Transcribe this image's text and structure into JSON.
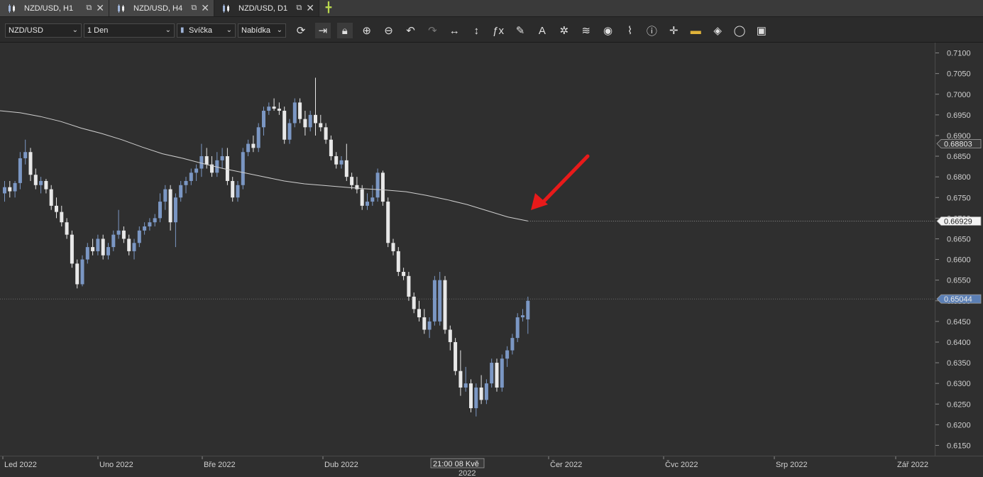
{
  "tabs": [
    {
      "label": "NZD/USD, H1",
      "active": false
    },
    {
      "label": "NZD/USD, H4",
      "active": false
    },
    {
      "label": "NZD/USD, D1",
      "active": true
    }
  ],
  "toolbar": {
    "symbol": "NZD/USD",
    "timeframe": "1 Den",
    "chart_type": "Svíčka",
    "price_side": "Nabídka",
    "tools": [
      "refresh-icon",
      "autoscroll-icon",
      "lock-icon",
      "zoom-in-icon",
      "zoom-out-icon",
      "undo-icon",
      "redo-icon",
      "horizontal-resize-icon",
      "vertical-resize-icon",
      "indicators-fx-icon",
      "pencil-draw-icon",
      "text-tool-icon",
      "crosshair-tools-icon",
      "layers-icon",
      "eye-icon",
      "pattern-icon",
      "info-icon",
      "crosshair-icon",
      "color-bar-icon",
      "fill-bucket-icon",
      "circle-icon",
      "save-icon"
    ]
  },
  "colors": {
    "bull": "#7b97c4",
    "bear": "#e8e8e8",
    "ma": "#cfcfcf",
    "arrow": "#e81a1a",
    "axis_bg": "#2f2f2f"
  },
  "y_labels": [
    "0.7100",
    "0.7050",
    "0.7000",
    "0.6950",
    "0.6900",
    "0.6850",
    "0.6800",
    "0.6750",
    "0.6700",
    "0.6650",
    "0.6600",
    "0.6550",
    "0.6500",
    "0.6450",
    "0.6400",
    "0.6350",
    "0.6300",
    "0.6250",
    "0.6200",
    "0.6150"
  ],
  "price_tags": [
    {
      "label": "0.68803",
      "value": 0.68803,
      "style": "gray"
    },
    {
      "label": "0.66929",
      "value": 0.66929,
      "style": "white"
    },
    {
      "label": "0.65044",
      "value": 0.65044,
      "style": "blue"
    }
  ],
  "x_labels": [
    "Led 2022",
    "Uno 2022",
    "Bře 2022",
    "Dub 2022",
    "Čer 2022",
    "Čvc 2022",
    "Srp 2022",
    "Zář 2022"
  ],
  "cursor_label": {
    "time": "21:00 08 Kvě",
    "year": "2022"
  },
  "chart_data": {
    "type": "candlestick",
    "ylim": [
      0.6125,
      0.7125
    ],
    "ohlc": [
      [
        0.676,
        0.679,
        0.674,
        0.6775
      ],
      [
        0.6775,
        0.679,
        0.675,
        0.6765
      ],
      [
        0.6765,
        0.679,
        0.675,
        0.6785
      ],
      [
        0.6785,
        0.686,
        0.677,
        0.6845
      ],
      [
        0.6845,
        0.689,
        0.683,
        0.686
      ],
      [
        0.686,
        0.687,
        0.679,
        0.6805
      ],
      [
        0.6805,
        0.682,
        0.677,
        0.678
      ],
      [
        0.678,
        0.68,
        0.676,
        0.679
      ],
      [
        0.679,
        0.6795,
        0.676,
        0.677
      ],
      [
        0.677,
        0.678,
        0.672,
        0.673
      ],
      [
        0.673,
        0.675,
        0.67,
        0.6715
      ],
      [
        0.6715,
        0.673,
        0.668,
        0.669
      ],
      [
        0.669,
        0.67,
        0.665,
        0.666
      ],
      [
        0.666,
        0.667,
        0.658,
        0.659
      ],
      [
        0.659,
        0.66,
        0.653,
        0.654
      ],
      [
        0.654,
        0.661,
        0.6535,
        0.66
      ],
      [
        0.66,
        0.664,
        0.659,
        0.663
      ],
      [
        0.663,
        0.665,
        0.661,
        0.662
      ],
      [
        0.662,
        0.666,
        0.661,
        0.665
      ],
      [
        0.665,
        0.666,
        0.66,
        0.661
      ],
      [
        0.661,
        0.664,
        0.66,
        0.663
      ],
      [
        0.663,
        0.667,
        0.662,
        0.666
      ],
      [
        0.666,
        0.672,
        0.665,
        0.667
      ],
      [
        0.667,
        0.668,
        0.664,
        0.665
      ],
      [
        0.665,
        0.666,
        0.661,
        0.662
      ],
      [
        0.662,
        0.665,
        0.66,
        0.664
      ],
      [
        0.664,
        0.668,
        0.663,
        0.667
      ],
      [
        0.667,
        0.669,
        0.666,
        0.668
      ],
      [
        0.668,
        0.67,
        0.667,
        0.669
      ],
      [
        0.669,
        0.671,
        0.668,
        0.67
      ],
      [
        0.67,
        0.676,
        0.669,
        0.674
      ],
      [
        0.674,
        0.678,
        0.672,
        0.677
      ],
      [
        0.677,
        0.678,
        0.667,
        0.669
      ],
      [
        0.669,
        0.676,
        0.663,
        0.675
      ],
      [
        0.675,
        0.679,
        0.674,
        0.678
      ],
      [
        0.678,
        0.68,
        0.676,
        0.679
      ],
      [
        0.679,
        0.682,
        0.678,
        0.681
      ],
      [
        0.681,
        0.683,
        0.679,
        0.682
      ],
      [
        0.682,
        0.688,
        0.68,
        0.685
      ],
      [
        0.685,
        0.687,
        0.682,
        0.683
      ],
      [
        0.683,
        0.685,
        0.68,
        0.681
      ],
      [
        0.681,
        0.686,
        0.68,
        0.684
      ],
      [
        0.684,
        0.687,
        0.682,
        0.685
      ],
      [
        0.685,
        0.687,
        0.678,
        0.679
      ],
      [
        0.679,
        0.68,
        0.674,
        0.675
      ],
      [
        0.675,
        0.679,
        0.674,
        0.678
      ],
      [
        0.678,
        0.687,
        0.677,
        0.686
      ],
      [
        0.686,
        0.689,
        0.685,
        0.688
      ],
      [
        0.688,
        0.69,
        0.686,
        0.687
      ],
      [
        0.687,
        0.693,
        0.686,
        0.692
      ],
      [
        0.692,
        0.697,
        0.69,
        0.696
      ],
      [
        0.696,
        0.698,
        0.695,
        0.697
      ],
      [
        0.697,
        0.699,
        0.696,
        0.6965
      ],
      [
        0.6965,
        0.698,
        0.695,
        0.696
      ],
      [
        0.696,
        0.697,
        0.688,
        0.689
      ],
      [
        0.689,
        0.694,
        0.688,
        0.693
      ],
      [
        0.693,
        0.699,
        0.692,
        0.698
      ],
      [
        0.698,
        0.699,
        0.693,
        0.694
      ],
      [
        0.694,
        0.696,
        0.69,
        0.692
      ],
      [
        0.692,
        0.696,
        0.691,
        0.695
      ],
      [
        0.695,
        0.704,
        0.69,
        0.693
      ],
      [
        0.693,
        0.695,
        0.691,
        0.692
      ],
      [
        0.692,
        0.693,
        0.688,
        0.689
      ],
      [
        0.689,
        0.69,
        0.684,
        0.685
      ],
      [
        0.685,
        0.686,
        0.682,
        0.683
      ],
      [
        0.683,
        0.685,
        0.682,
        0.684
      ],
      [
        0.684,
        0.688,
        0.679,
        0.68
      ],
      [
        0.68,
        0.681,
        0.677,
        0.678
      ],
      [
        0.678,
        0.68,
        0.676,
        0.677
      ],
      [
        0.677,
        0.678,
        0.672,
        0.673
      ],
      [
        0.673,
        0.676,
        0.672,
        0.674
      ],
      [
        0.674,
        0.678,
        0.673,
        0.675
      ],
      [
        0.675,
        0.682,
        0.674,
        0.681
      ],
      [
        0.681,
        0.6815,
        0.673,
        0.674
      ],
      [
        0.674,
        0.675,
        0.663,
        0.664
      ],
      [
        0.664,
        0.665,
        0.661,
        0.662
      ],
      [
        0.662,
        0.663,
        0.656,
        0.657
      ],
      [
        0.657,
        0.658,
        0.655,
        0.656
      ],
      [
        0.656,
        0.657,
        0.65,
        0.651
      ],
      [
        0.651,
        0.652,
        0.647,
        0.648
      ],
      [
        0.648,
        0.65,
        0.645,
        0.646
      ],
      [
        0.646,
        0.648,
        0.642,
        0.643
      ],
      [
        0.643,
        0.646,
        0.641,
        0.645
      ],
      [
        0.645,
        0.656,
        0.644,
        0.655
      ],
      [
        0.645,
        0.657,
        0.644,
        0.655
      ],
      [
        0.655,
        0.656,
        0.642,
        0.643
      ],
      [
        0.643,
        0.644,
        0.638,
        0.64
      ],
      [
        0.64,
        0.641,
        0.632,
        0.633
      ],
      [
        0.633,
        0.638,
        0.627,
        0.629
      ],
      [
        0.629,
        0.634,
        0.628,
        0.63
      ],
      [
        0.63,
        0.631,
        0.623,
        0.624
      ],
      [
        0.624,
        0.63,
        0.622,
        0.629
      ],
      [
        0.629,
        0.632,
        0.625,
        0.626
      ],
      [
        0.626,
        0.631,
        0.625,
        0.63
      ],
      [
        0.63,
        0.636,
        0.629,
        0.635
      ],
      [
        0.635,
        0.636,
        0.628,
        0.629
      ],
      [
        0.629,
        0.637,
        0.628,
        0.636
      ],
      [
        0.636,
        0.639,
        0.634,
        0.638
      ],
      [
        0.638,
        0.642,
        0.637,
        0.641
      ],
      [
        0.641,
        0.647,
        0.64,
        0.646
      ],
      [
        0.646,
        0.648,
        0.645,
        0.6465
      ],
      [
        0.6455,
        0.651,
        0.642,
        0.65
      ]
    ],
    "ma": [
      0.696,
      0.6955,
      0.6946,
      0.6934,
      0.6918,
      0.6905,
      0.689,
      0.6872,
      0.6856,
      0.6845,
      0.6832,
      0.682,
      0.681,
      0.68,
      0.679,
      0.6783,
      0.6779,
      0.6775,
      0.6771,
      0.6768,
      0.6764,
      0.6755,
      0.6745,
      0.6733,
      0.6718,
      0.6703,
      0.6693
    ],
    "ma_name": "",
    "markers": {
      "current_price": 0.65044,
      "ma_value": 0.66929,
      "ma_tag": 0.68803
    }
  }
}
